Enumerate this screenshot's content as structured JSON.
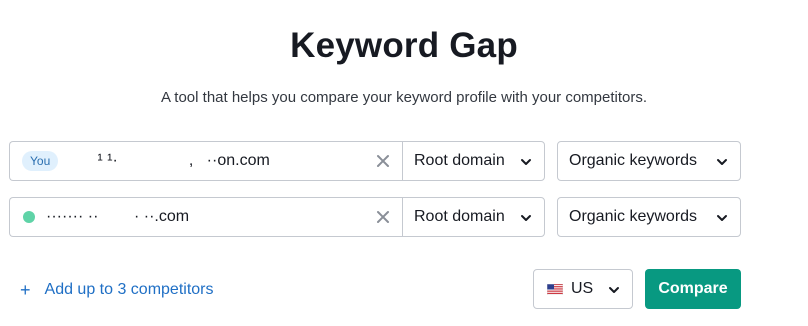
{
  "page": {
    "title": "Keyword Gap",
    "subtitle": "A tool that helps you compare your keyword profile with your competitors."
  },
  "rows": [
    {
      "badge": "You",
      "domain_value": "   ¹ ¹·                ,   ··on.com",
      "type": "Root domain",
      "keywords": "Organic keywords"
    },
    {
      "marker_color": "#5fd3a7",
      "domain_value": "······· ··        · ··.com",
      "type": "Root domain",
      "keywords": "Organic keywords"
    }
  ],
  "actions": {
    "add_plus": "+",
    "add_label": "Add up to 3 competitors",
    "country": "US",
    "country_icon": "us-flag-icon",
    "compare_label": "Compare"
  },
  "colors": {
    "accent": "#089981",
    "link": "#1f6fc5",
    "badge_bg": "#e0f0fd",
    "badge_text": "#2b6fb0"
  }
}
